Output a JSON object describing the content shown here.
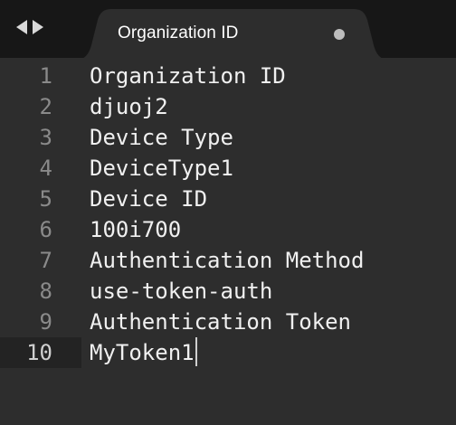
{
  "tab": {
    "title": "Organization ID",
    "modified_indicator": "unsaved-dot-icon"
  },
  "editor": {
    "lines": [
      {
        "number": "1",
        "text": "Organization ID"
      },
      {
        "number": "2",
        "text": "djuoj2"
      },
      {
        "number": "3",
        "text": "Device Type"
      },
      {
        "number": "4",
        "text": "DeviceType1"
      },
      {
        "number": "5",
        "text": "Device ID"
      },
      {
        "number": "6",
        "text": "100i700"
      },
      {
        "number": "7",
        "text": "Authentication Method"
      },
      {
        "number": "8",
        "text": "use-token-auth"
      },
      {
        "number": "9",
        "text": "Authentication Token"
      },
      {
        "number": "10",
        "text": "MyToken1"
      }
    ],
    "current_line": "10"
  },
  "colors": {
    "tabbar_bg": "#171717",
    "editor_bg": "#2d2d2d",
    "text": "#f0f0f0",
    "line_number": "#8a8a8a"
  }
}
